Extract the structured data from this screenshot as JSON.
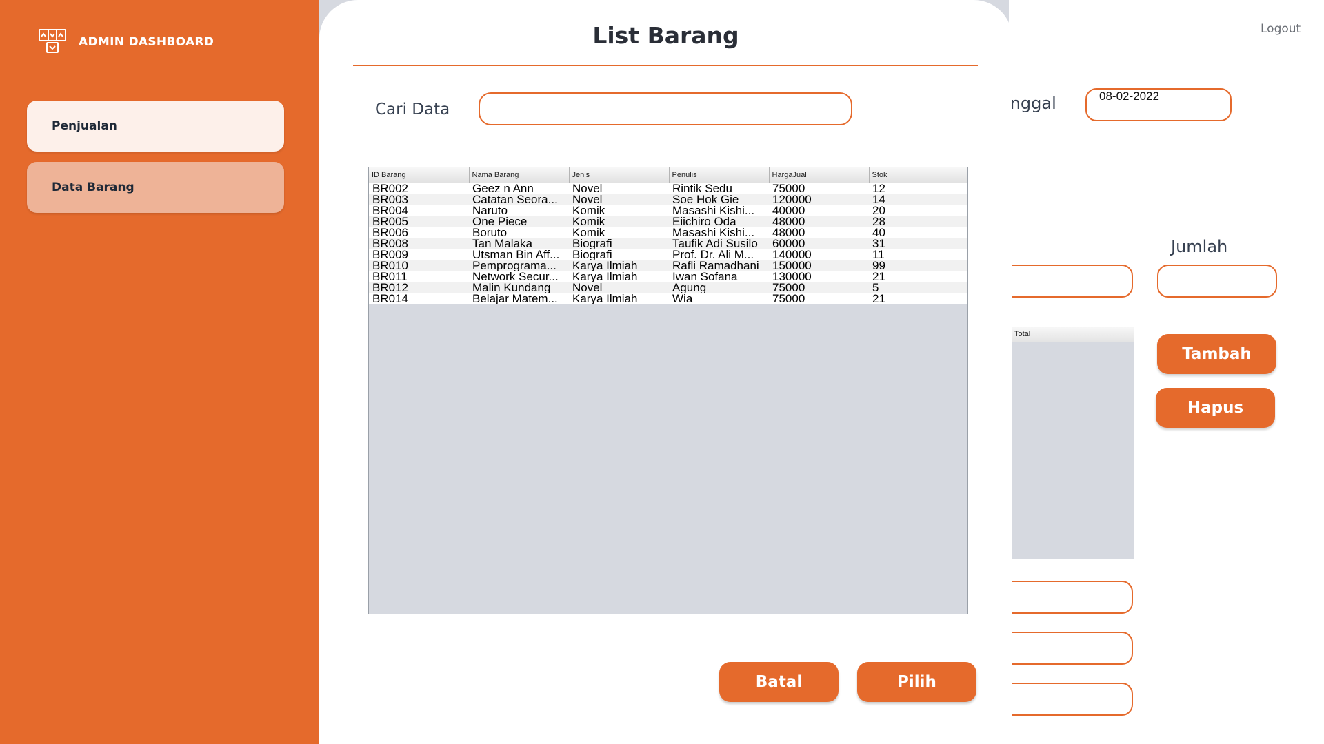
{
  "sidebar": {
    "brand": "ADMIN DASHBOARD",
    "brand_icon": "sitemap-icon",
    "items": [
      {
        "label": "Penjualan",
        "state": "default"
      },
      {
        "label": "Data Barang",
        "state": "active"
      }
    ]
  },
  "header": {
    "logout_label": "Logout"
  },
  "background_form": {
    "tanggal_label": "anggal",
    "tanggal_value": "08-02-2022",
    "jumlah_label": "Jumlah",
    "total_column": "Total",
    "tambah_label": "Tambah",
    "hapus_label": "Hapus"
  },
  "modal": {
    "title": "List Barang",
    "search_label": "Cari Data",
    "search_value": "",
    "columns": [
      "ID Barang",
      "Nama Barang",
      "Jenis",
      "Penulis",
      "HargaJual",
      "Stok"
    ],
    "rows": [
      [
        "BR002",
        "Geez n Ann",
        "Novel",
        "Rintik Sedu",
        "75000",
        "12"
      ],
      [
        "BR003",
        "Catatan Seora...",
        "Novel",
        "Soe Hok Gie",
        "120000",
        "14"
      ],
      [
        "BR004",
        "Naruto",
        "Komik",
        "Masashi Kishi...",
        "40000",
        "20"
      ],
      [
        "BR005",
        "One Piece",
        "Komik",
        "Eiichiro Oda",
        "48000",
        "28"
      ],
      [
        "BR006",
        "Boruto",
        "Komik",
        "Masashi Kishi...",
        "48000",
        "40"
      ],
      [
        "BR008",
        "Tan Malaka",
        "Biografi",
        "Taufik Adi Susilo",
        "60000",
        "31"
      ],
      [
        "BR009",
        "Utsman Bin Aff...",
        "Biografi",
        "Prof. Dr. Ali M...",
        "140000",
        "11"
      ],
      [
        "BR010",
        "Pemprograma...",
        "Karya Ilmiah",
        "Rafli Ramadhani",
        "150000",
        "99"
      ],
      [
        "BR011",
        "Network Secur...",
        "Karya Ilmiah",
        "Iwan Sofana",
        "130000",
        "21"
      ],
      [
        "BR012",
        "Malin Kundang",
        "Novel",
        "Agung",
        "75000",
        "5"
      ],
      [
        "BR014",
        "Belajar Matem...",
        "Karya Ilmiah",
        "Wia",
        "75000",
        "21"
      ]
    ],
    "cancel_label": "Batal",
    "select_label": "Pilih"
  },
  "colors": {
    "accent": "#E56A2C",
    "sidebar_active": "#EEB397",
    "sidebar_item": "#FDF0EA",
    "backdrop": "#D6D9E0"
  }
}
